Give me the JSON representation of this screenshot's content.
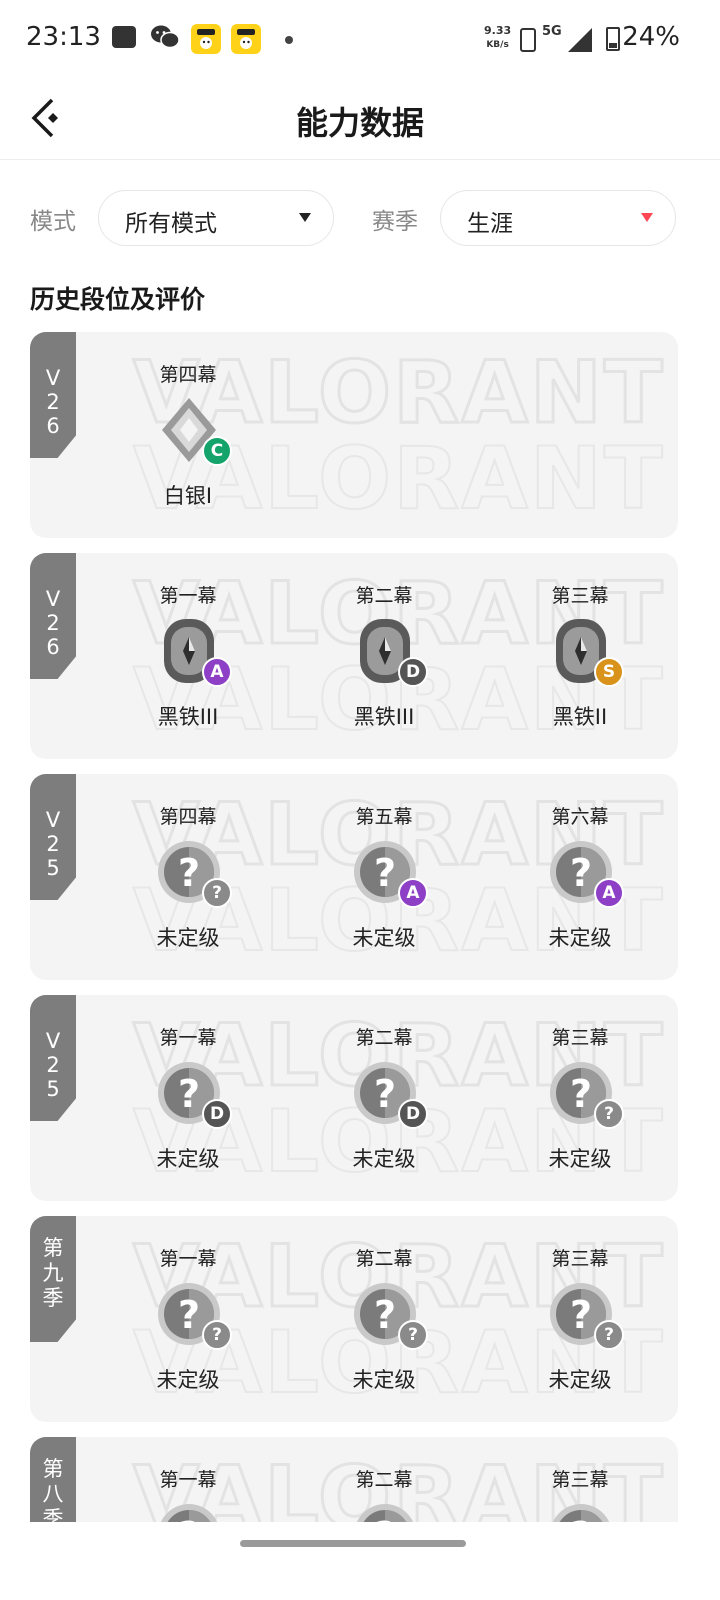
{
  "status_bar": {
    "time": "23:13",
    "speed_value": "9.33",
    "speed_unit": "KB/s",
    "network": "5G",
    "battery": "24%",
    "app_icon_text": "闲鱼"
  },
  "header": {
    "title": "能力数据"
  },
  "filters": {
    "mode_label": "模式",
    "mode_value": "所有模式",
    "season_label": "赛季",
    "season_value": "生涯"
  },
  "section_title": "历史段位及评价",
  "cards": [
    {
      "season": "V26",
      "acts": [
        {
          "label": "第四幕",
          "rank": "白银I",
          "rank_type": "silver",
          "grade": "C"
        }
      ]
    },
    {
      "season": "V26",
      "acts": [
        {
          "label": "第一幕",
          "rank": "黑铁III",
          "rank_type": "iron",
          "grade": "A"
        },
        {
          "label": "第二幕",
          "rank": "黑铁III",
          "rank_type": "iron",
          "grade": "D"
        },
        {
          "label": "第三幕",
          "rank": "黑铁II",
          "rank_type": "iron",
          "grade": "S"
        }
      ]
    },
    {
      "season": "V25",
      "acts": [
        {
          "label": "第四幕",
          "rank": "未定级",
          "rank_type": "unranked",
          "grade": "?"
        },
        {
          "label": "第五幕",
          "rank": "未定级",
          "rank_type": "unranked",
          "grade": "A"
        },
        {
          "label": "第六幕",
          "rank": "未定级",
          "rank_type": "unranked",
          "grade": "A"
        }
      ]
    },
    {
      "season": "V25",
      "acts": [
        {
          "label": "第一幕",
          "rank": "未定级",
          "rank_type": "unranked",
          "grade": "D"
        },
        {
          "label": "第二幕",
          "rank": "未定级",
          "rank_type": "unranked",
          "grade": "D"
        },
        {
          "label": "第三幕",
          "rank": "未定级",
          "rank_type": "unranked",
          "grade": "?"
        }
      ]
    },
    {
      "season": "第九季",
      "acts": [
        {
          "label": "第一幕",
          "rank": "未定级",
          "rank_type": "unranked",
          "grade": "?"
        },
        {
          "label": "第二幕",
          "rank": "未定级",
          "rank_type": "unranked",
          "grade": "?"
        },
        {
          "label": "第三幕",
          "rank": "未定级",
          "rank_type": "unranked",
          "grade": "?"
        }
      ]
    },
    {
      "season": "第八季",
      "acts": [
        {
          "label": "第一幕",
          "rank": "",
          "rank_type": "unranked",
          "grade": ""
        },
        {
          "label": "第二幕",
          "rank": "",
          "rank_type": "unranked",
          "grade": ""
        },
        {
          "label": "第三幕",
          "rank": "",
          "rank_type": "unranked",
          "grade": ""
        }
      ]
    }
  ],
  "watermark_text": "VALORANT",
  "colors": {
    "grade_A": "#8d3fc6",
    "grade_C": "#14a36a",
    "grade_D": "#555555",
    "grade_S": "#d9931a",
    "accent_red": "#ff4655"
  }
}
